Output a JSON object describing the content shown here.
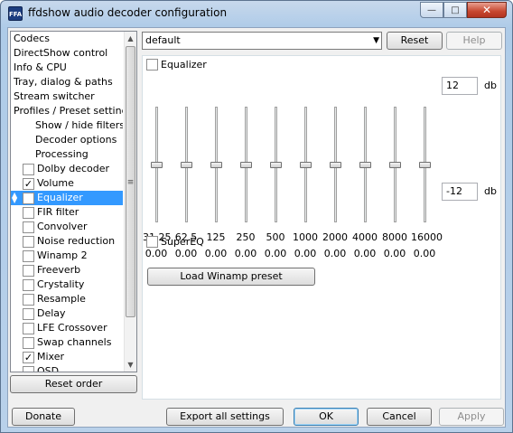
{
  "window": {
    "title": "ffdshow audio decoder configuration",
    "icon_text": "FFA"
  },
  "caption": {
    "minimize": "—",
    "maximize": "□",
    "close": "✕"
  },
  "sidebar": {
    "items": [
      {
        "label": "Codecs",
        "level": 0
      },
      {
        "label": "DirectShow control",
        "level": 0
      },
      {
        "label": "Info & CPU",
        "level": 0
      },
      {
        "label": "Tray, dialog & paths",
        "level": 0
      },
      {
        "label": "Stream switcher",
        "level": 0
      },
      {
        "label": "Profiles / Preset settings",
        "level": 0
      },
      {
        "label": "Show / hide filters",
        "level": 1
      },
      {
        "label": "Decoder options",
        "level": 1
      },
      {
        "label": "Processing",
        "level": 1
      },
      {
        "label": "Dolby decoder",
        "checkbox": true,
        "checked": false
      },
      {
        "label": "Volume",
        "checkbox": true,
        "checked": true
      },
      {
        "label": "Equalizer",
        "checkbox": true,
        "checked": false,
        "selected": true
      },
      {
        "label": "FIR filter",
        "checkbox": true,
        "checked": false
      },
      {
        "label": "Convolver",
        "checkbox": true,
        "checked": false
      },
      {
        "label": "Noise reduction",
        "checkbox": true,
        "checked": false
      },
      {
        "label": "Winamp 2",
        "checkbox": true,
        "checked": false
      },
      {
        "label": "Freeverb",
        "checkbox": true,
        "checked": false
      },
      {
        "label": "Crystality",
        "checkbox": true,
        "checked": false
      },
      {
        "label": "Resample",
        "checkbox": true,
        "checked": false
      },
      {
        "label": "Delay",
        "checkbox": true,
        "checked": false
      },
      {
        "label": "LFE Crossover",
        "checkbox": true,
        "checked": false
      },
      {
        "label": "Swap channels",
        "checkbox": true,
        "checked": false
      },
      {
        "label": "Mixer",
        "checkbox": true,
        "checked": true
      },
      {
        "label": "OSD",
        "checkbox": true,
        "checked": false
      }
    ],
    "reset_order_label": "Reset order"
  },
  "preset": {
    "value": "default",
    "reset_label": "Reset",
    "help_label": "Help"
  },
  "equalizer": {
    "enable_label": "Equalizer",
    "enabled": false,
    "max_db": "12",
    "min_db": "-12",
    "db_unit": "db",
    "bands": [
      {
        "freq": "31.25",
        "value": "0.00"
      },
      {
        "freq": "62.5",
        "value": "0.00"
      },
      {
        "freq": "125",
        "value": "0.00"
      },
      {
        "freq": "250",
        "value": "0.00"
      },
      {
        "freq": "500",
        "value": "0.00"
      },
      {
        "freq": "1000",
        "value": "0.00"
      },
      {
        "freq": "2000",
        "value": "0.00"
      },
      {
        "freq": "4000",
        "value": "0.00"
      },
      {
        "freq": "8000",
        "value": "0.00"
      },
      {
        "freq": "16000",
        "value": "0.00"
      }
    ],
    "supereq_label": "SuperEQ",
    "supereq_checked": false,
    "load_winamp_label": "Load Winamp preset"
  },
  "footer": {
    "donate_label": "Donate",
    "export_label": "Export all settings",
    "ok_label": "OK",
    "cancel_label": "Cancel",
    "apply_label": "Apply"
  }
}
